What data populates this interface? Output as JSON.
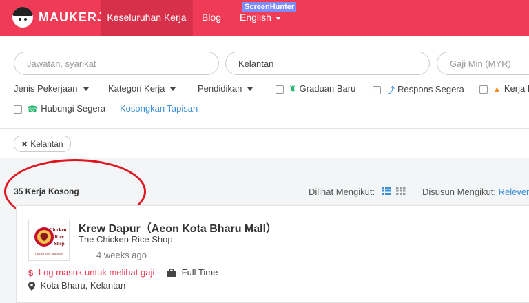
{
  "nav": {
    "brand": "MAUKERJA",
    "items": [
      {
        "label": "Keseluruhan Kerja"
      },
      {
        "label": "Blog"
      },
      {
        "label": "English"
      }
    ],
    "overlay_tag": "ScreenHunter",
    "colors": {
      "bar": "#ef3b56",
      "active": "#d7304a"
    }
  },
  "search": {
    "keyword_placeholder": "Jawatan, syarikat",
    "location_value": "Kelantan",
    "salary_placeholder": "Gaji Min (MYR)"
  },
  "filters": {
    "dropdowns": [
      "Jenis Pekerjaan",
      "Kategori Kerja",
      "Pendidikan"
    ],
    "checkboxes": [
      {
        "label": "Graduan Baru",
        "icon": "graduate-icon"
      },
      {
        "label": "Respons Segera",
        "icon": "lightning-icon"
      },
      {
        "label": "Kerja P",
        "icon": "fire-icon"
      },
      {
        "label": "Hubungi Segera",
        "icon": "phone-icon"
      }
    ],
    "clear_link": "Kosongkan Tapisan"
  },
  "active_filter": {
    "label": "Kelantan"
  },
  "results": {
    "count_text": "35 Kerja Kosong",
    "view_label": "Dilihat Mengikut:",
    "sort_label": "Disusun Mengikut:",
    "sort_value": "Relevence"
  },
  "job": {
    "title": "Krew Dapur（Aeon Kota Bharu Mall）",
    "company": "The Chicken Rice Shop",
    "posted": "4 weeks ago",
    "salary": "Log masuk untuk melihat gaji",
    "type": "Full Time",
    "location": "Kota Bharu, Kelantan",
    "logo_text": [
      "Chicken",
      "Rice",
      "Shop"
    ],
    "logo_tagline": "Chicken Rice...and More"
  }
}
